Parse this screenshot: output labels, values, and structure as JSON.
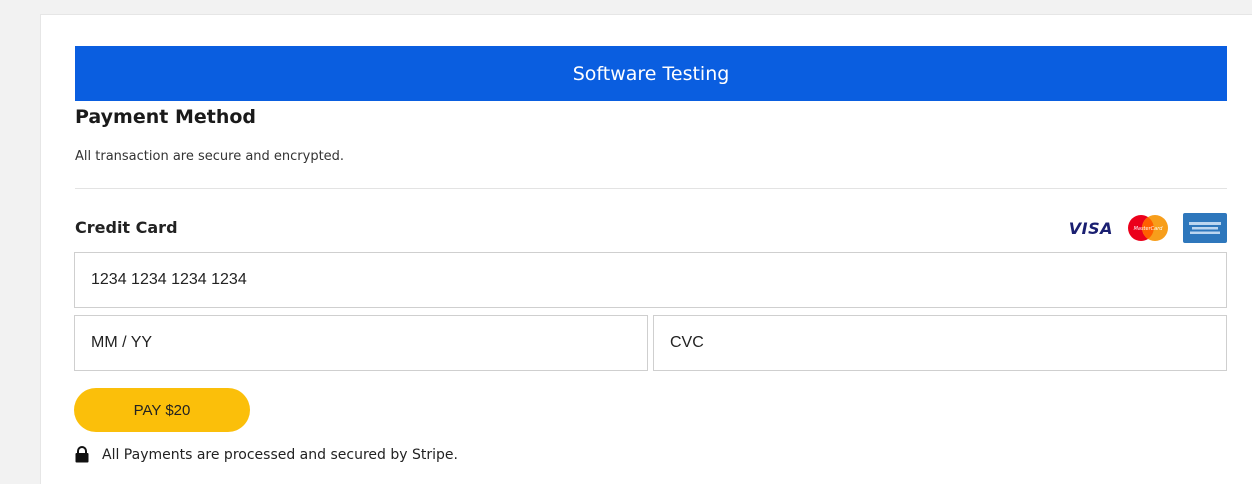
{
  "banner": {
    "title": "Software Testing"
  },
  "payment_method": {
    "title": "Payment Method",
    "subtitle": "All transaction are secure and encrypted."
  },
  "credit_card": {
    "label": "Credit Card",
    "brands": [
      "VISA",
      "MasterCard",
      "American Express"
    ],
    "number_placeholder": "1234 1234 1234 1234",
    "expiry_placeholder": "MM / YY",
    "cvc_placeholder": "CVC"
  },
  "pay_button": {
    "label": "PAY $20"
  },
  "security_note": {
    "text": "All Payments are processed and secured by Stripe.",
    "icon": "lock-icon"
  },
  "colors": {
    "banner": "#0a5ee0",
    "pay_button": "#fbbf0a"
  }
}
